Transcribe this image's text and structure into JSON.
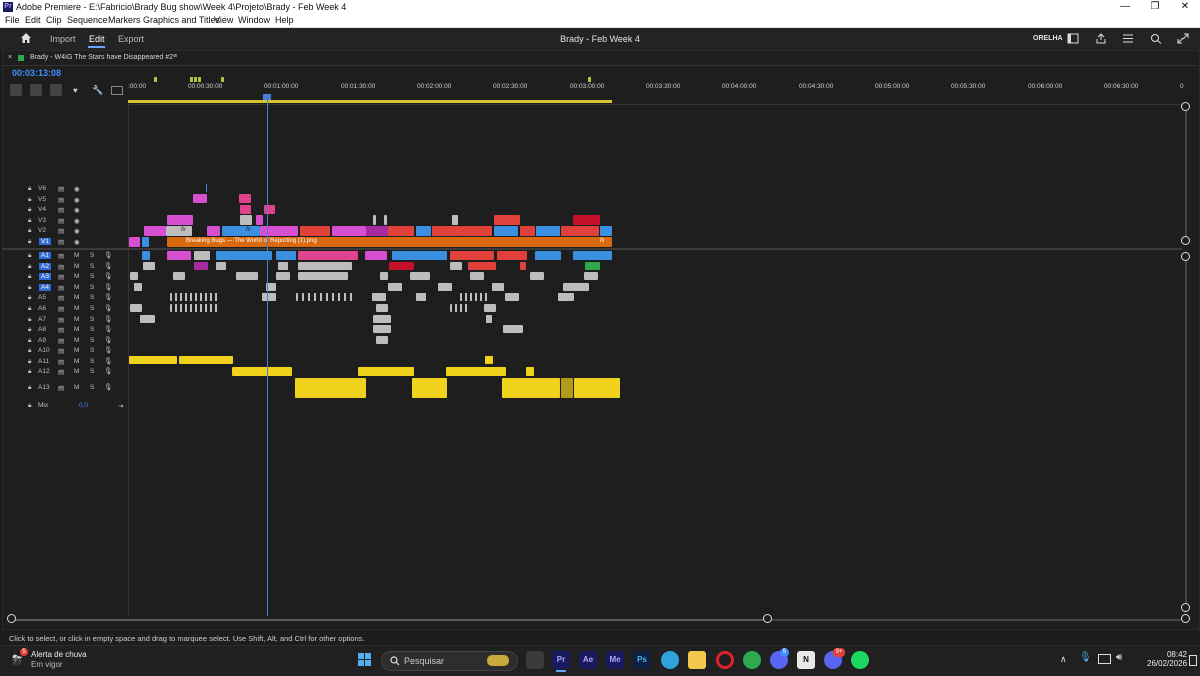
{
  "window": {
    "title": "Adobe Premiere - E:\\Fabricio\\Brady Bug show\\Week 4\\Projeto\\Brady - Feb Week 4",
    "minimize": "—",
    "maximize": "❐",
    "close": "✕"
  },
  "menu": [
    "File",
    "Edit",
    "Clip",
    "Sequence",
    "Markers",
    "Graphics and Titles",
    "View",
    "Window",
    "Help"
  ],
  "header": {
    "workspaces": [
      "Import",
      "Edit",
      "Export"
    ],
    "active_workspace": "Edit",
    "project_title": "Brady - Feb Week 4",
    "audio_device_label": "ORELHA"
  },
  "sequence": {
    "tab_close": "×",
    "tab_name": "Brady - W4IG The Stars have Disappeared #2",
    "menu_glyph": "≡",
    "timecode": "00:03:13:08"
  },
  "ruler": {
    "labels": [
      ":00:00",
      "00:00:30:00",
      "00:01:00:00",
      "00:01:30:00",
      "00:02:00:00",
      "00:02:30:00",
      "00:03:00:00",
      "00:03:30:00",
      "00:04:00:00",
      "00:04:30:00",
      "00:05:00:00",
      "00:05:30:00",
      "00:06:00:00",
      "00:06:30:00",
      "0"
    ]
  },
  "tracks": {
    "video": [
      "V6",
      "V5",
      "V4",
      "V3",
      "V2",
      "V1"
    ],
    "audio": [
      "A1",
      "A2",
      "A3",
      "A4",
      "A5",
      "A6",
      "A7",
      "A8",
      "A9",
      "A10",
      "A11",
      "A12",
      "A13"
    ],
    "mute_label": "M",
    "solo_label": "S",
    "mix_label": "Mix",
    "mix_value": "0,0"
  },
  "clips": {
    "v1_title": "Breaking Bugs --- The World of Reporting (1).png",
    "fx": "fx"
  },
  "status_text": "Click to select, or click in empty space and drag to marquee select. Use Shift, Alt, and Ctrl for other options.",
  "taskbar": {
    "weather_badge": "5",
    "weather_title": "Alerta de chuva",
    "weather_sub": "Em vigor",
    "search_placeholder": "Pesquisar",
    "apps": [
      "Pr",
      "Ae",
      "Me",
      "Ps"
    ],
    "discord_badge": "5",
    "discord2_badge": "9+",
    "time": "08:42",
    "date": "26/02/2026"
  },
  "colors": {
    "accent": "#3d8fff",
    "clip_pink": "#d64fd0",
    "clip_blue": "#3a8fe0",
    "clip_red": "#e0413a",
    "clip_orange": "#d8690f",
    "clip_yellow": "#f0d21c",
    "clip_gray": "#bdbdbd"
  }
}
